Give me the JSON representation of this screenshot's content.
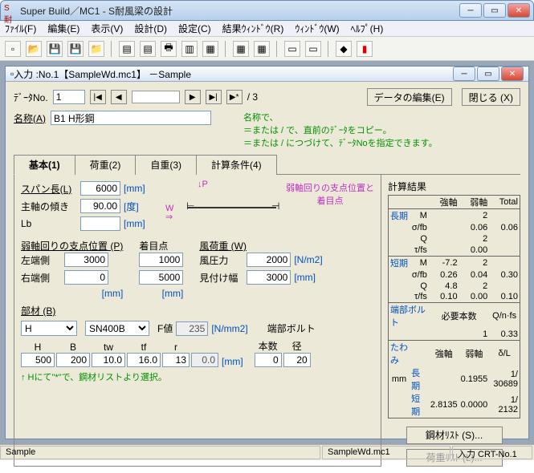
{
  "window": {
    "title": "Super Build／MC1 - S耐風梁の設計"
  },
  "menus": [
    "ﾌｧｲﾙ(F)",
    "編集(E)",
    "表示(V)",
    "設計(D)",
    "設定(C)",
    "結果ｳｨﾝﾄﾞｳ(R)",
    "ｳｨﾝﾄﾞｳ(W)",
    "ﾍﾙﾌﾟ(H)"
  ],
  "child": {
    "title": "入力 :No.1【SampleWd.mc1】 －Sample"
  },
  "datano": {
    "label": "ﾃﾞｰﾀNo.",
    "value": "1",
    "total": "/ 3"
  },
  "buttons": {
    "edit": "データの編集(E)",
    "close": "閉じる (X)",
    "steel_list": "鋼材ﾘｽﾄ (S)...",
    "load_list": "荷重ﾘｽﾄ (L)..."
  },
  "name": {
    "label": "名称(A)",
    "value": "B1 H形鋼"
  },
  "help": {
    "line1": "名称で、",
    "line2": "＝または / で、直前のﾃﾞｰﾀをコピー。",
    "line3": "＝または / につづけて、ﾃﾞｰﾀNoを指定できます。"
  },
  "tabs": [
    "基本(1)",
    "荷重(2)",
    "自重(3)",
    "計算条件(4)"
  ],
  "basic": {
    "span": {
      "label": "スパン長(L)",
      "value": "6000",
      "unit": "[mm]"
    },
    "tilt": {
      "label": "主軸の傾き",
      "value": "90.00",
      "unit": "[度]"
    },
    "lb": {
      "label": "Lb",
      "value": "",
      "unit": "[mm]"
    },
    "diagram_label": "弱軸回りの支点位置と着目点",
    "weak_support": {
      "title": "弱軸回りの支点位置 (P)",
      "left_label": "左端側",
      "left_value": "3000",
      "right_label": "右端側",
      "right_value": "0",
      "unit": "[mm]"
    },
    "focus": {
      "title": "着目点",
      "v1": "1000",
      "v2": "5000",
      "unit": "[mm]"
    },
    "wind": {
      "title": "風荷重 (W)",
      "press_label": "風圧力",
      "press_value": "2000",
      "press_unit": "[N/m2]",
      "width_label": "見付け幅",
      "width_value": "3000",
      "width_unit": "[mm]"
    },
    "member": {
      "title": "部材 (B)",
      "shape": "H",
      "grade": "SN400B",
      "fvalue_label": "F値",
      "fvalue": "235",
      "fvalue_unit": "[N/mm2]",
      "end_bolt": "端部ボルト",
      "bolt_n_label": "本数",
      "bolt_n": "0",
      "bolt_d_label": "径",
      "bolt_d": "20",
      "H_label": "H",
      "B_label": "B",
      "tw_label": "tw",
      "tf_label": "tf",
      "r_label": "r",
      "H": "500",
      "B": "200",
      "tw": "10.0",
      "tf": "16.0",
      "r": "13",
      "r2": "0.0",
      "unit": "[mm]",
      "note": "↑ Hにて\"*\"で、鋼材リストより選択。"
    }
  },
  "results": {
    "title": "計算結果",
    "hdr": [
      "",
      "",
      "強軸",
      "弱軸",
      "Total"
    ],
    "long_label": "長期",
    "short_label": "短期",
    "rows_long": [
      [
        "",
        "M",
        "",
        "2",
        ""
      ],
      [
        "",
        "σ/fb",
        "",
        "0.06",
        "0.06"
      ],
      [
        "",
        "Q",
        "",
        "2",
        ""
      ],
      [
        "",
        "τ/fs",
        "",
        "0.00",
        ""
      ]
    ],
    "rows_short": [
      [
        "",
        "M",
        "-7.2",
        "2",
        ""
      ],
      [
        "",
        "σ/fb",
        "0.26",
        "0.04",
        "0.30"
      ],
      [
        "",
        "Q",
        "4.8",
        "2",
        ""
      ],
      [
        "",
        "τ/fs",
        "0.10",
        "0.00",
        "0.10"
      ]
    ],
    "bolt": {
      "label": "端部ボルト",
      "need": "必要本数",
      "need_v": "1",
      "qnfs": "Q/n·fs",
      "qnfs_v": "0.33"
    },
    "defl": {
      "label": "たわみ",
      "c1": "強軸",
      "c2": "弱軸",
      "c3": "δ/L",
      "mm": "mm",
      "long": "長期",
      "short": "短期",
      "long_v": [
        "",
        "0.1955",
        "1/ 30689"
      ],
      "short_v": [
        "2.8135",
        "0.0000",
        "1/ 2132"
      ]
    }
  },
  "status": {
    "left": "Sample",
    "mid": "SampleWd.mc1",
    "right": "入力 CRT-No.1"
  }
}
